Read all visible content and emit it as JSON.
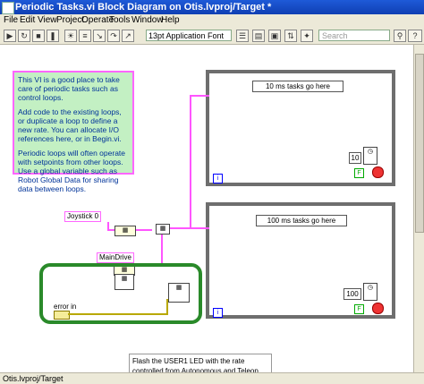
{
  "window": {
    "title": "Periodic Tasks.vi Block Diagram on Otis.lvproj/Target *"
  },
  "menu": [
    "File",
    "Edit",
    "View",
    "Project",
    "Operate",
    "Tools",
    "Window",
    "Help"
  ],
  "toolbar": {
    "font_selector": "13pt Application Font",
    "search_placeholder": "Search"
  },
  "diagram": {
    "comment_paragraphs": [
      "This VI is a good place to take care of periodic tasks such as control loops.",
      "Add code to the existing loops, or duplicate a loop to define a new rate. You can allocate I/O references here, or in Begin.vi.",
      "Periodic loops will often operate with setpoints from other loops. Use a global variable such as Robot Global Data for sharing data between loops."
    ],
    "loop1_label": "10 ms tasks go here",
    "loop1_wait": "10",
    "loop2_label": "100 ms tasks go here",
    "loop2_wait": "100",
    "joystick_label": "Joystick 0",
    "maindrive_label": "MainDrive",
    "error_in_label": "error in",
    "info_glyph": "i",
    "stop_glyph": "F",
    "flash_comment": "Flash the USER1 LED with the rate controlled from Autonomous and Teleop"
  },
  "status": {
    "path": "Otis.lvproj/Target"
  },
  "colors": {
    "wire_refnum": "#ff55ff",
    "wire_error": "#b8a800",
    "comment_bg": "#c3f0c3",
    "titlebar": "#1e5ad8"
  }
}
